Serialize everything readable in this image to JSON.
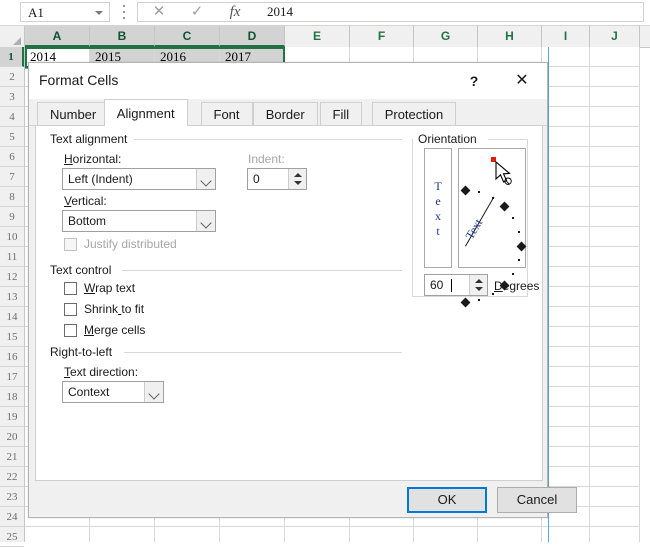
{
  "spreadsheet": {
    "name_box": "A1",
    "formula_bar_value": "2014",
    "formula_icons": {
      "cancel": "✕",
      "enter": "✓",
      "function": "fx"
    },
    "columns": [
      "A",
      "B",
      "C",
      "D",
      "E",
      "F",
      "G",
      "H",
      "I",
      "J"
    ],
    "selected_columns": [
      "A",
      "B",
      "C",
      "D"
    ],
    "rows": [
      "1",
      "2",
      "3",
      "4",
      "5",
      "6",
      "7",
      "8",
      "9",
      "10",
      "11",
      "12",
      "13",
      "14",
      "15",
      "16",
      "17",
      "18",
      "19",
      "20",
      "21",
      "22",
      "23",
      "24",
      "25"
    ],
    "selected_row": "1",
    "row1_values": [
      "2014",
      "2015",
      "2016",
      "2017"
    ],
    "active_cell_value": "2014"
  },
  "dialog": {
    "title": "Format Cells",
    "help_glyph": "?",
    "close_glyph": "✕",
    "tabs": [
      {
        "label": "Number",
        "active": false
      },
      {
        "label": "Alignment",
        "active": true
      },
      {
        "label": "Font",
        "active": false
      },
      {
        "label": "Border",
        "active": false
      },
      {
        "label": "Fill",
        "active": false
      },
      {
        "label": "Protection",
        "active": false
      }
    ],
    "text_alignment": {
      "group_title": "Text alignment",
      "horizontal_label": "Horizontal:",
      "horizontal_value": "Left (Indent)",
      "vertical_label": "Vertical:",
      "vertical_value": "Bottom",
      "justify_distributed_label": "Justify distributed",
      "justify_distributed_checked": false,
      "justify_distributed_enabled": false,
      "indent_label": "Indent:",
      "indent_value": "0",
      "indent_label_enabled": false
    },
    "text_control": {
      "group_title": "Text control",
      "items": [
        {
          "label": "Wrap text",
          "checked": false
        },
        {
          "label": "Shrink to fit",
          "checked": false
        },
        {
          "label": "Merge cells",
          "checked": false
        }
      ]
    },
    "right_to_left": {
      "group_title": "Right-to-left",
      "text_direction_label": "Text direction:",
      "text_direction_value": "Context"
    },
    "orientation": {
      "group_title": "Orientation",
      "preview_vertical_text": "Text",
      "preview_rotated_text": "Text",
      "degrees_value": "60",
      "degrees_label": "Degrees",
      "handle_color": "#e8190c"
    },
    "buttons": {
      "ok": "OK",
      "cancel": "Cancel"
    }
  }
}
